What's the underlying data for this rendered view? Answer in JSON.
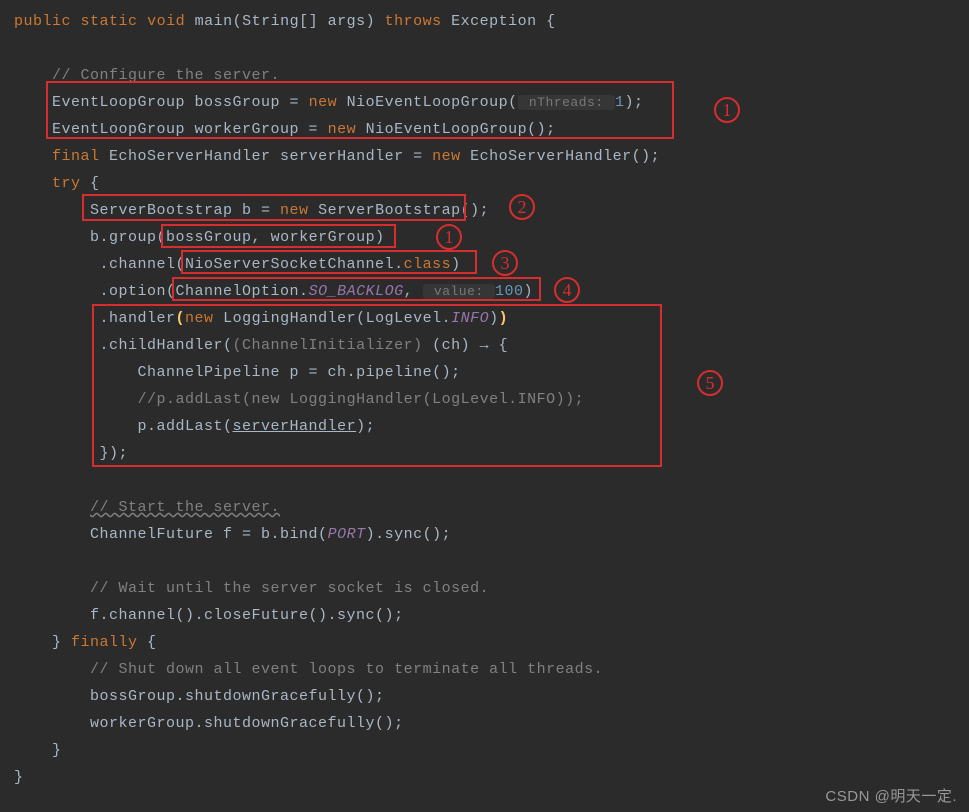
{
  "code": {
    "l1_public": "public",
    "l1_static": "static",
    "l1_void": "void",
    "l1_main": "main(String[] args)",
    "l1_throws": "throws",
    "l1_exc": "Exception {",
    "l3_comment": "// Configure the server.",
    "l4_a": "EventLoopGroup bossGroup = ",
    "l4_new": "new",
    "l4_b": " NioEventLoopGroup(",
    "l4_hint": " nThreads: ",
    "l4_num": "1",
    "l4_c": ");",
    "l5_a": "EventLoopGroup workerGroup = ",
    "l5_new": "new",
    "l5_b": " NioEventLoopGroup();",
    "l6_final": "final",
    "l6_a": " EchoServerHandler serverHandler = ",
    "l6_new": "new",
    "l6_b": " EchoServerHandler();",
    "l7_try": "try",
    "l7_brace": " {",
    "l8_a": "ServerBootstrap b = ",
    "l8_new": "new",
    "l8_b": " ServerBootstrap();",
    "l9_a": "b.group(",
    "l9_b": "bossGroup",
    "l9_c": ", ",
    "l9_d": "workerGroup",
    "l9_e": ")",
    "l10_a": " .channel(",
    "l10_b": "NioServerSocketChannel.",
    "l10_class": "class",
    "l10_c": ")",
    "l11_a": " .option(",
    "l11_b": "ChannelOption.",
    "l11_so": "SO_BACKLOG",
    "l11_c": ", ",
    "l11_hint": " value: ",
    "l11_num": "100",
    "l11_d": ")",
    "l12_a": " .handler",
    "l12_p1": "(",
    "l12_new": "new",
    "l12_b": " LoggingHandler(LogLevel.",
    "l12_info": "INFO",
    "l12_c": ")",
    "l12_p2": ")",
    "l13_a": " .childHandler(",
    "l13_cast": "(ChannelInitializer) ",
    "l13_b": "(ch) → {",
    "l14_a": "ChannelPipeline p = ch.pipeline();",
    "l15_comment": "//p.addLast(new LoggingHandler(LogLevel.INFO));",
    "l16_a": "p.addLast(",
    "l16_b": "serverHandler",
    "l16_c": ");",
    "l17_a": "});",
    "l19_comment": "// Start the server.",
    "l20_a": "ChannelFuture f = b.bind(",
    "l20_port": "PORT",
    "l20_b": ").sync();",
    "l22_comment": "// Wait until the server socket is closed.",
    "l23_a": "f.channel().closeFuture().sync();",
    "l24_a": "} ",
    "l24_finally": "finally",
    "l24_b": " {",
    "l25_comment": "// Shut down all event loops to terminate all threads.",
    "l26_a": "bossGroup.shutdownGracefully();",
    "l27_a": "workerGroup.shutdownGracefully();",
    "l28_a": "}",
    "l29_a": "}"
  },
  "annotations": {
    "circle1": "1",
    "circle2": "2",
    "circle3": "3",
    "circle4": "4",
    "circle5": "5"
  },
  "watermark": "CSDN @明天一定."
}
